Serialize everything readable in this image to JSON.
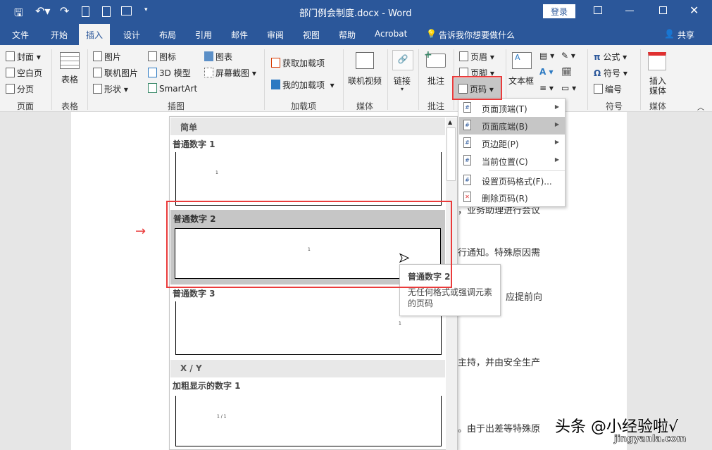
{
  "title_bar": {
    "title": "部门例会制度.docx  -  Word",
    "login": "登录",
    "quick_access": [
      "save-icon",
      "undo-icon",
      "redo-icon",
      "new-document-icon",
      "print-preview-icon",
      "touch-mode-icon",
      "customize-icon"
    ]
  },
  "tabs": [
    {
      "label": "文件"
    },
    {
      "label": "开始"
    },
    {
      "label": "插入"
    },
    {
      "label": "设计"
    },
    {
      "label": "布局"
    },
    {
      "label": "引用"
    },
    {
      "label": "邮件"
    },
    {
      "label": "审阅"
    },
    {
      "label": "视图"
    },
    {
      "label": "帮助"
    },
    {
      "label": "Acrobat"
    }
  ],
  "tell_me": "告诉我你想要做什么",
  "share": "共享",
  "ribbon": {
    "pages": {
      "items": [
        "封面",
        "空白页",
        "分页"
      ],
      "group": "页面"
    },
    "table": {
      "label": "表格",
      "group": "表格"
    },
    "illustrations": {
      "items": [
        "图片",
        "联机图片",
        "形状",
        "图标",
        "3D 模型",
        "SmartArt",
        "图表",
        "屏幕截图"
      ],
      "group": "插图"
    },
    "addins": {
      "items": [
        "获取加载项",
        "我的加载项"
      ],
      "group": "加载项"
    },
    "media": {
      "label": "联机视频",
      "group": "媒体"
    },
    "links": {
      "label": "链接"
    },
    "comments": {
      "label": "批注",
      "group": "批注"
    },
    "header_footer": {
      "items": [
        "页眉",
        "页脚",
        "页码"
      ]
    },
    "text": {
      "label": "文本框"
    },
    "symbols": {
      "items": [
        "公式",
        "符号",
        "编号"
      ],
      "group": "符号"
    },
    "insert_media": {
      "label": "插入\n媒体",
      "line1": "插入",
      "line2": "媒体",
      "group": "媒体"
    }
  },
  "page_number_menu": [
    {
      "label": "页面顶端(T)",
      "submenu": true
    },
    {
      "label": "页面底端(B)",
      "submenu": true,
      "highlighted": true
    },
    {
      "label": "页边距(P)",
      "submenu": true
    },
    {
      "label": "当前位置(C)",
      "submenu": true
    },
    {
      "label": "设置页码格式(F)..."
    },
    {
      "label": "删除页码(R)"
    }
  ],
  "gallery": {
    "section1": "简单",
    "items": [
      {
        "label": "普通数字 1",
        "num": "1"
      },
      {
        "label": "普通数字 2",
        "num": "1",
        "selected": true
      },
      {
        "label": "普通数字 3",
        "num": "1"
      }
    ],
    "section2": "X / Y",
    "items2": [
      {
        "label": "加粗显示的数字 1",
        "num": "1 / 1"
      }
    ]
  },
  "tooltip": {
    "title": "普通数字 2",
    "desc": "无任何格式或强调元素的页码"
  },
  "document_lines": [
    "，业务助理进行会议",
    "行通知。特殊原因需",
    "应提前向",
    "主持，并由安全生产",
    "。由于出差等特殊原"
  ],
  "watermark": {
    "line1": "头条 @小经验啦√",
    "line2": "jingyanla.com"
  },
  "colors": {
    "brand": "#2b579a",
    "highlight": "#ea3b3b"
  }
}
